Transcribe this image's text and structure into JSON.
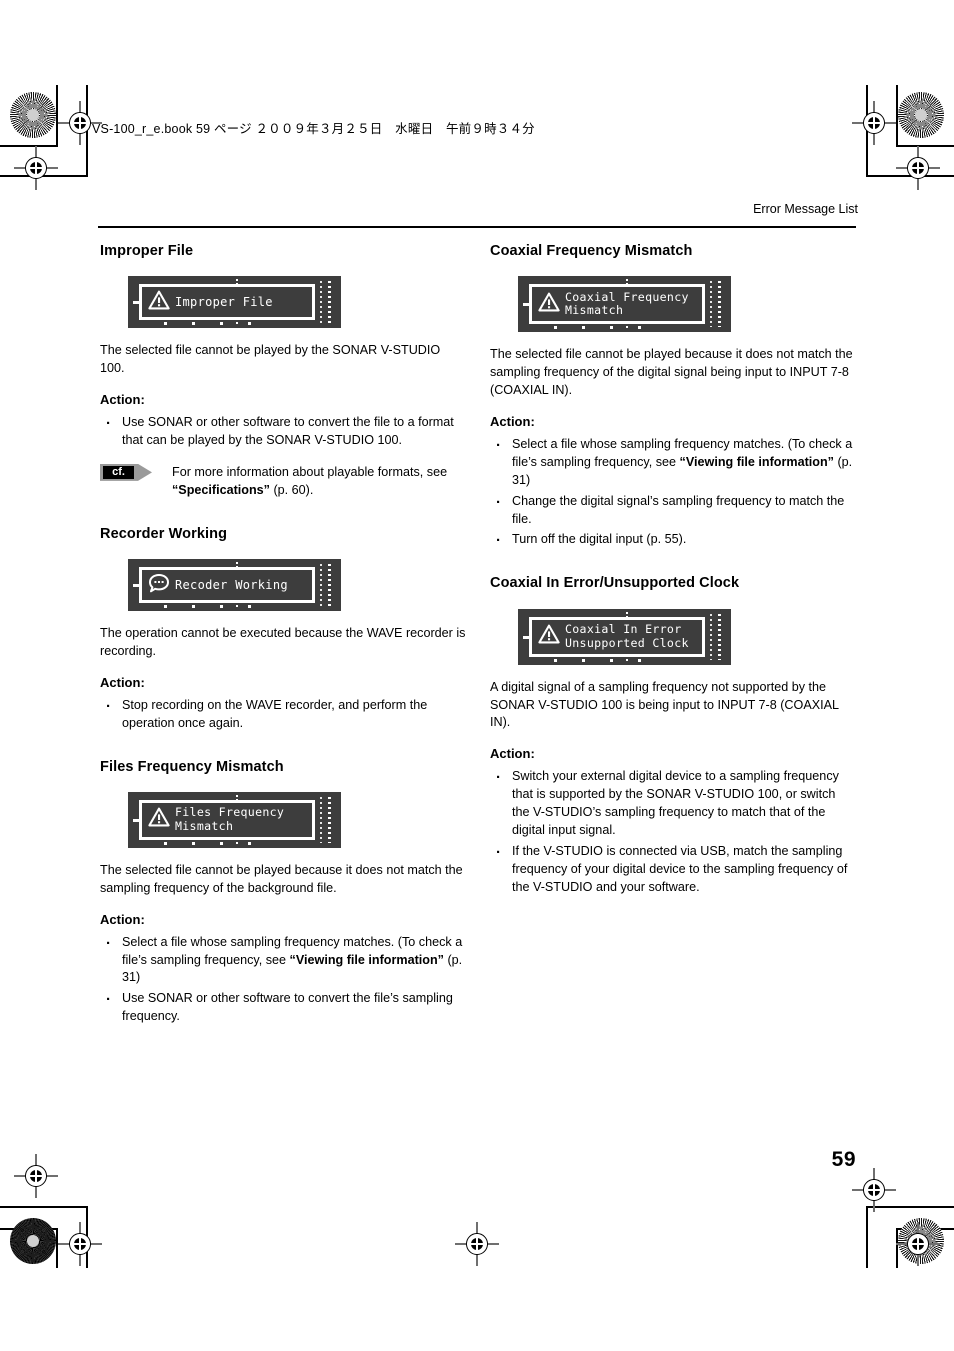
{
  "print_header": {
    "book_line": "VS-100_r_e.book  59 ページ  ２００９年３月２５日　水曜日　午前９時３４分"
  },
  "running_head": "Error Message List",
  "page_number": "59",
  "colors": {
    "lcd_background": "#3d3d3d",
    "lcd_foreground": "#ffffff",
    "text": "#000000",
    "rule": "#000000"
  },
  "columns": {
    "left": [
      {
        "heading": "Improper File",
        "lcd": {
          "icon": "warning-triangle-icon",
          "lines": [
            "Improper File"
          ]
        },
        "body": "The selected file cannot be played by the SONAR V-STUDIO 100.",
        "action_label": "Action:",
        "bullets": [
          {
            "parts": [
              {
                "text": "Use SONAR or other software to convert the file to a format that can be played by the SONAR V-STUDIO 100.",
                "bold": false
              }
            ]
          }
        ],
        "callout": {
          "tag": "cf.",
          "parts": [
            {
              "text": "For more information about playable formats, see ",
              "bold": false
            },
            {
              "text": "“Specifications”",
              "bold": true
            },
            {
              "text": " (p. 60).",
              "bold": false
            }
          ]
        }
      },
      {
        "heading": "Recorder Working",
        "lcd": {
          "icon": "busy-bubble-icon",
          "lines": [
            "Recoder Working"
          ]
        },
        "body": "The operation cannot be executed because the WAVE recorder is recording.",
        "action_label": "Action:",
        "bullets": [
          {
            "parts": [
              {
                "text": "Stop recording on the WAVE recorder, and perform the operation once again.",
                "bold": false
              }
            ]
          }
        ]
      },
      {
        "heading": "Files Frequency Mismatch",
        "lcd": {
          "icon": "warning-triangle-icon",
          "lines": [
            "Files Frequency",
            "Mismatch"
          ]
        },
        "body": "The selected file cannot be played because it does not match the sampling frequency of the background file.",
        "action_label": "Action:",
        "bullets": [
          {
            "parts": [
              {
                "text": "Select a file whose sampling frequency matches. (To check a file’s sampling frequency, see ",
                "bold": false
              },
              {
                "text": "“Viewing file information”",
                "bold": true
              },
              {
                "text": " (p. 31)",
                "bold": false
              }
            ]
          },
          {
            "parts": [
              {
                "text": "Use SONAR or other software to convert the file’s sampling frequency.",
                "bold": false
              }
            ]
          }
        ]
      }
    ],
    "right": [
      {
        "heading": "Coaxial Frequency Mismatch",
        "lcd": {
          "icon": "warning-triangle-icon",
          "lines": [
            "Coaxial Frequency",
            "Mismatch"
          ]
        },
        "body": "The selected file cannot be played because it does not match the sampling frequency of the digital signal being input to INPUT 7-8 (COAXIAL IN).",
        "action_label": "Action:",
        "bullets": [
          {
            "parts": [
              {
                "text": "Select a file whose sampling frequency matches. (To check a file’s sampling frequency, see ",
                "bold": false
              },
              {
                "text": "“Viewing file information”",
                "bold": true
              },
              {
                "text": " (p. 31)",
                "bold": false
              }
            ]
          },
          {
            "parts": [
              {
                "text": "Change the digital signal’s sampling frequency to match the file.",
                "bold": false
              }
            ]
          },
          {
            "parts": [
              {
                "text": "Turn off the digital input (p. 55).",
                "bold": false
              }
            ]
          }
        ]
      },
      {
        "heading": "Coaxial In Error/Unsupported Clock",
        "lcd": {
          "icon": "warning-triangle-icon",
          "lines": [
            "Coaxial In Error",
            "Unsupported Clock"
          ]
        },
        "body": "A digital signal of a sampling frequency not supported by the SONAR V-STUDIO 100 is being input to INPUT 7-8 (COAXIAL IN).",
        "action_label": "Action:",
        "bullets": [
          {
            "parts": [
              {
                "text": "Switch your external digital device to a sampling frequency that is supported by the SONAR V-STUDIO 100, or switch the V-STUDIO’s sampling frequency to match that of the digital input signal.",
                "bold": false
              }
            ]
          },
          {
            "parts": [
              {
                "text": "If the V-STUDIO is connected via USB, match the sampling frequency of your digital device to the sampling frequency of the V-STUDIO and your software.",
                "bold": false
              }
            ]
          }
        ]
      }
    ]
  }
}
